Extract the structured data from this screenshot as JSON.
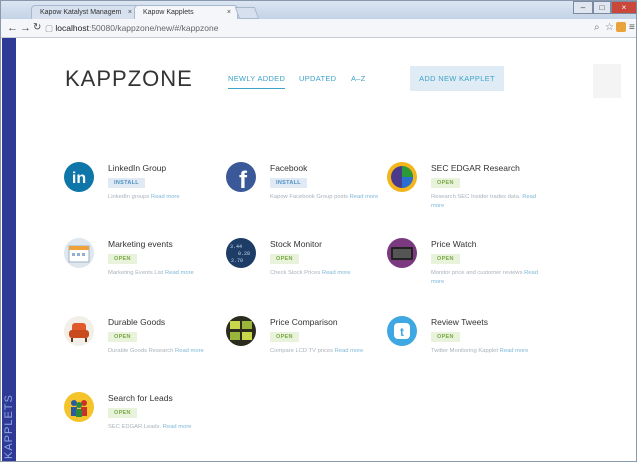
{
  "browser": {
    "tabs": [
      {
        "title": "Kapow Katalyst Managem",
        "close": "×"
      },
      {
        "title": "Kapow Kapplets",
        "close": "×"
      }
    ],
    "address": {
      "host": "localhost",
      "path": ":50080/kappzone/new/#/kappzone"
    },
    "window_controls": [
      "–",
      "□",
      "×"
    ]
  },
  "sidebar": {
    "label": "KAPPLETS"
  },
  "header": {
    "logo": "KAPPZONE",
    "tabs": [
      {
        "label": "NEWLY ADDED",
        "active": true
      },
      {
        "label": "UPDATED"
      },
      {
        "label": "A–Z"
      }
    ],
    "add_button": "ADD NEW KAPPLET"
  },
  "apps": [
    {
      "title": "LinkedIn Group",
      "badge": "INSTALL",
      "desc": "LinkedIn groups",
      "more": "Read more",
      "icon": "linkedin-icon",
      "color": "#0e76a8"
    },
    {
      "title": "Facebook",
      "badge": "INSTALL",
      "desc": "Kapow Facebook Group posts",
      "more": "Read more",
      "icon": "facebook-icon",
      "color": "#3b5998"
    },
    {
      "title": "SEC EDGAR Research",
      "badge": "OPEN",
      "desc": "Research SEC Insider trades data.",
      "more": "Read more",
      "icon": "pie-chart-icon",
      "color": "#f2b51b"
    },
    {
      "title": "Marketing events",
      "badge": "OPEN",
      "desc": "Marketing Events List",
      "more": "Read more",
      "icon": "calendar-icon",
      "color": "#dfe7ee"
    },
    {
      "title": "Stock Monitor",
      "badge": "OPEN",
      "desc": "Check Stock Prices",
      "more": "Read more",
      "icon": "stock-ticker-icon",
      "color": "#1e3d66"
    },
    {
      "title": "Price Watch",
      "badge": "OPEN",
      "desc": "Monitor price and customer reviews",
      "more": "Read more",
      "icon": "tv-icon",
      "color": "#7b3a80"
    },
    {
      "title": "Durable Goods",
      "badge": "OPEN",
      "desc": "Durable Goods Research",
      "more": "Read more",
      "icon": "armchair-icon",
      "color": "#e05a2b"
    },
    {
      "title": "Price Comparison",
      "badge": "OPEN",
      "desc": "Compare LCD TV prices",
      "more": "Read more",
      "icon": "price-tags-icon",
      "color": "#6a8a1f"
    },
    {
      "title": "Review Tweets",
      "badge": "OPEN",
      "desc": "Twitter Monitoring Kapplet",
      "more": "Read more",
      "icon": "twitter-icon",
      "color": "#3fa7e1"
    },
    {
      "title": "Search for Leads",
      "badge": "OPEN",
      "desc": "SEC EDGAR Leads.",
      "more": "Read more",
      "icon": "people-icon",
      "color": "#f5c42a"
    }
  ]
}
